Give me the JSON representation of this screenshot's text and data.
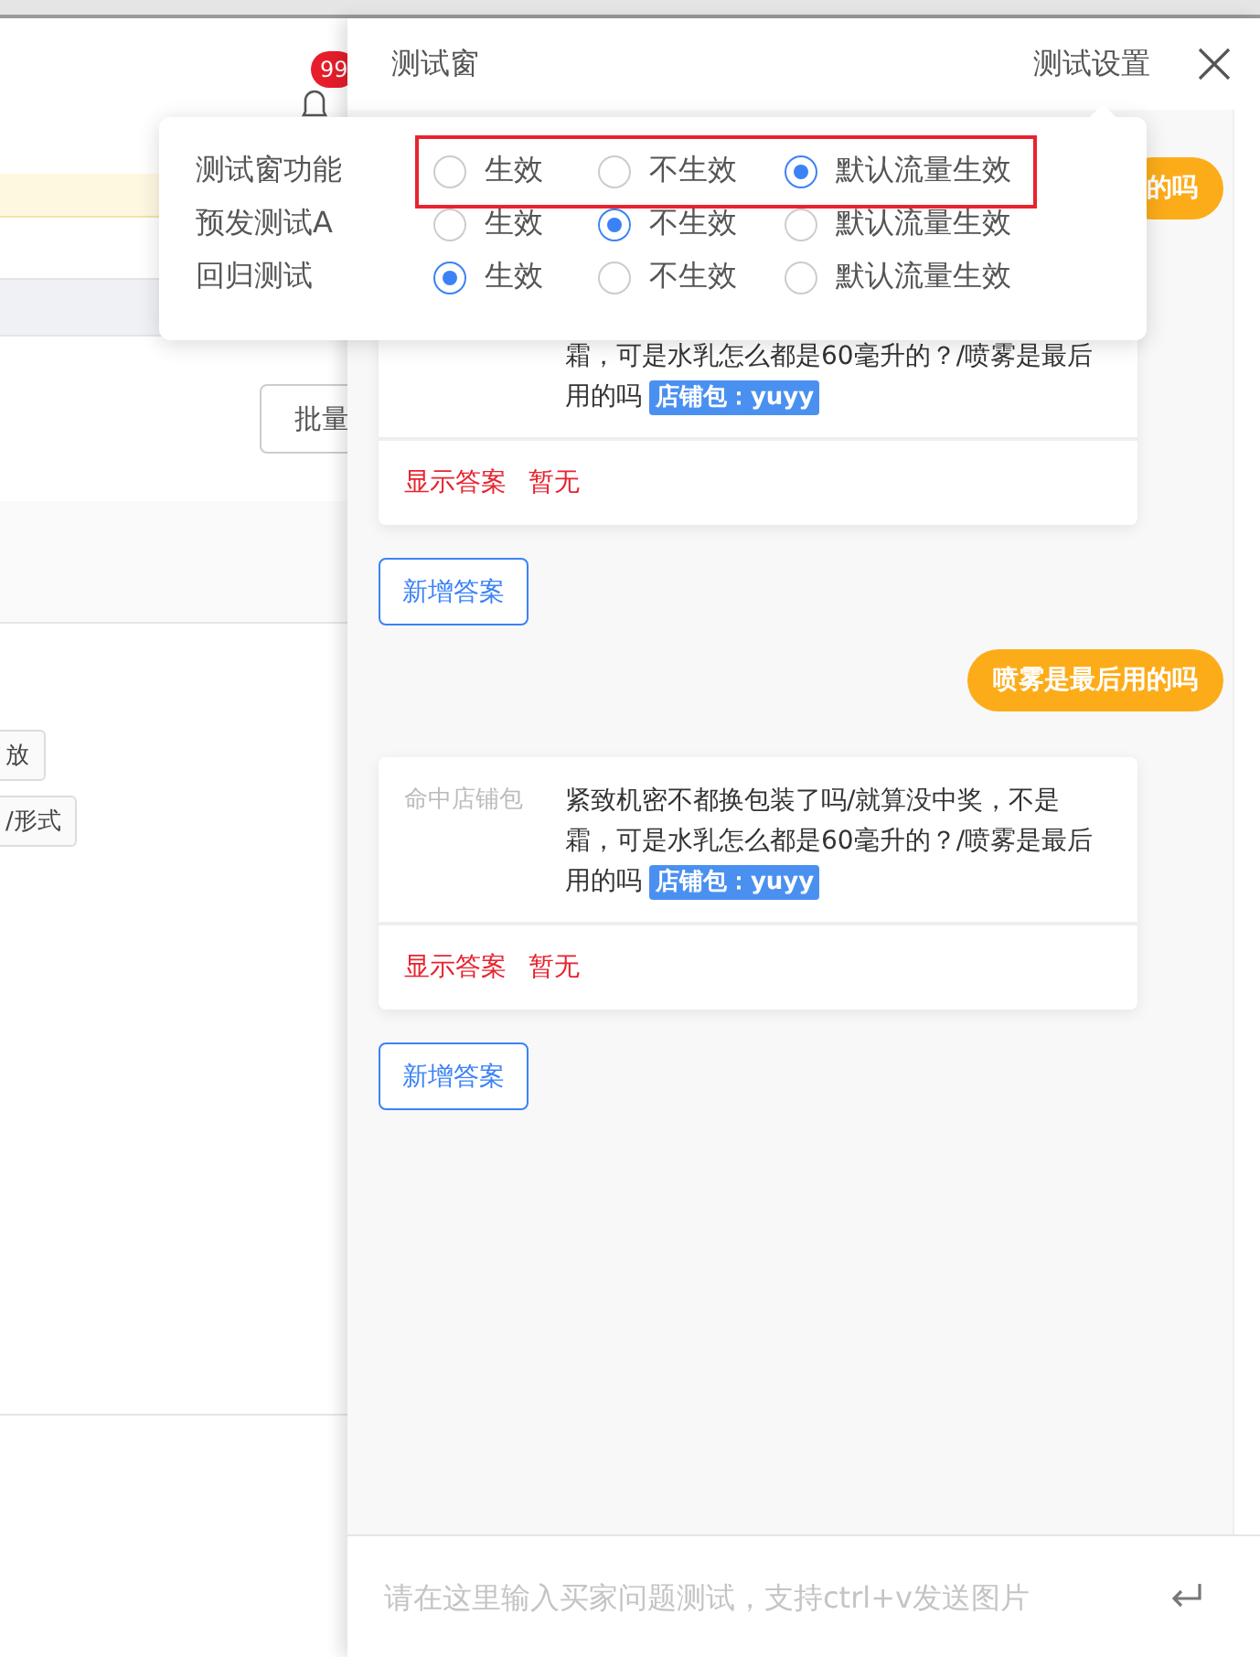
{
  "page": {
    "badge": "99",
    "button": "批量",
    "tags": [
      "放",
      "/形式"
    ]
  },
  "drawer": {
    "title": "测试窗",
    "settings_link": "测试设置",
    "messages": [
      {
        "kind": "question",
        "text": "的吗"
      },
      {
        "kind": "answer",
        "text": "霜，可是水乳怎么都是60毫升的？/喷雾是最后用的吗",
        "tag": "店铺包：yuyy",
        "show": "显示答案",
        "none": "暂无"
      },
      {
        "kind": "add",
        "text": "新增答案"
      },
      {
        "kind": "question",
        "text": "喷雾是最后用的吗"
      },
      {
        "kind": "answer",
        "label": "命中店铺包",
        "text": "紧致机密不都换包装了吗/就算没中奖，不是霜，可是水乳怎么都是60毫升的？/喷雾是最后用的吗",
        "tag": "店铺包：yuyy",
        "show": "显示答案",
        "none": "暂无"
      },
      {
        "kind": "add",
        "text": "新增答案"
      }
    ],
    "input": {
      "placeholder": "请在这里输入买家问题测试，支持ctrl+v发送图片"
    }
  },
  "settings": [
    {
      "label": "测试窗功能",
      "highlighted": true,
      "options": [
        {
          "label": "生效",
          "selected": false
        },
        {
          "label": "不生效",
          "selected": false
        },
        {
          "label": "默认流量生效",
          "selected": true
        }
      ]
    },
    {
      "label": "预发测试A",
      "highlighted": false,
      "options": [
        {
          "label": "生效",
          "selected": false
        },
        {
          "label": "不生效",
          "selected": true
        },
        {
          "label": "默认流量生效",
          "selected": false
        }
      ]
    },
    {
      "label": "回归测试",
      "highlighted": false,
      "options": [
        {
          "label": "生效",
          "selected": true
        },
        {
          "label": "不生效",
          "selected": false
        },
        {
          "label": "默认流量生效",
          "selected": false
        }
      ]
    }
  ]
}
